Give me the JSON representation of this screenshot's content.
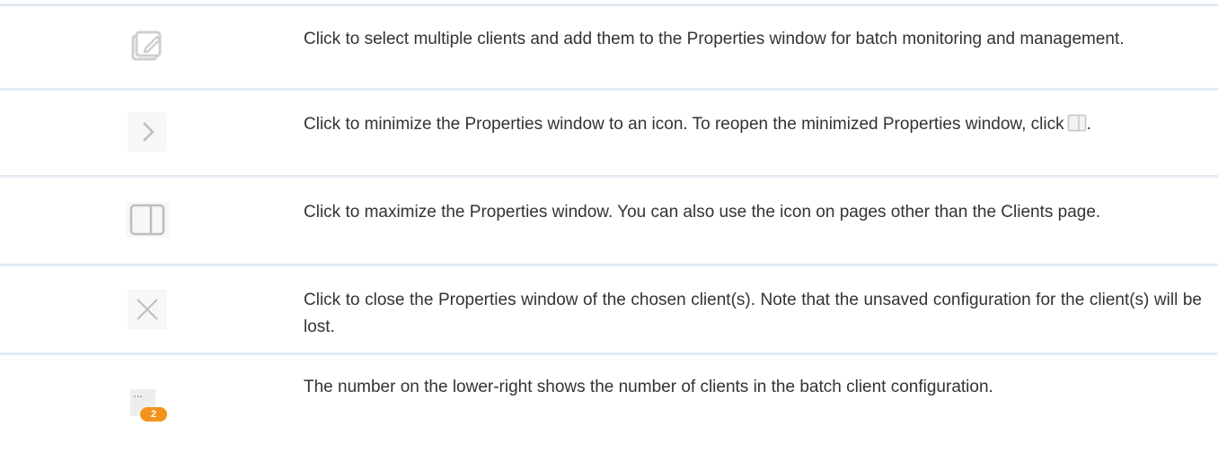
{
  "rows": [
    {
      "icon": "edit-icon",
      "text": "Click to select multiple clients and add them to the Properties window for batch monitoring and management."
    },
    {
      "icon": "chevron-right-icon",
      "text": "Click to minimize the Properties window to an icon. To reopen the minimized Properties window, click",
      "text_end": "."
    },
    {
      "icon": "panel-icon",
      "text": "Click to maximize the Properties window. You can also use the icon on pages other than the Clients page."
    },
    {
      "icon": "close-icon",
      "text": "Click to close the Properties window of the chosen client(s). Note that the unsaved configuration for the client(s) will be lost."
    },
    {
      "icon": "batch-clients-icon",
      "badge": "2",
      "dots": "···",
      "text": "The number on the lower-right shows the number of clients in the batch client configuration."
    }
  ],
  "colors": {
    "divider": "#e3ebf3",
    "icon_bg": "#f5f5f5",
    "icon_stroke": "#c8c8c8",
    "badge": "#f2931d",
    "text": "#333333"
  }
}
